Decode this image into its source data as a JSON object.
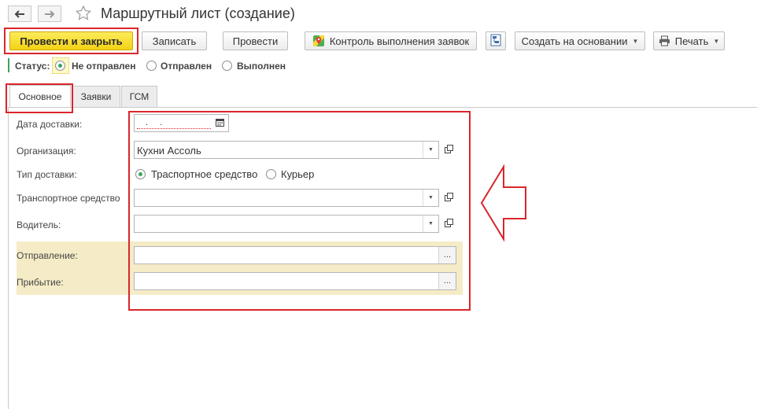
{
  "window": {
    "title": "Маршрутный лист (создание)"
  },
  "nav": {
    "back_icon": "arrow-left-icon",
    "forward_icon": "arrow-right-icon",
    "favorite_icon": "star-icon"
  },
  "toolbar": {
    "post_close_label": "Провести и закрыть",
    "save_label": "Записать",
    "post_label": "Провести",
    "control_label": "Контроль выполнения заявок",
    "create_based_label": "Создать на основании",
    "print_label": "Печать"
  },
  "status": {
    "label": "Статус:",
    "options": [
      "Не отправлен",
      "Отправлен",
      "Выполнен"
    ],
    "selected": "Не отправлен"
  },
  "tabs": [
    "Основное",
    "Заявки",
    "ГСМ"
  ],
  "active_tab": "Основное",
  "form": {
    "delivery_date": {
      "label": "Дата доставки:",
      "value": ". ."
    },
    "organization": {
      "label": "Организация:",
      "value": "Кухни Ассоль"
    },
    "delivery_type": {
      "label": "Тип доставки:",
      "options": [
        "Траспортное средство",
        "Курьер"
      ],
      "selected": "Траспортное средство"
    },
    "vehicle": {
      "label": "Транспортное средство",
      "value": ""
    },
    "driver": {
      "label": "Водитель:",
      "value": ""
    },
    "departure": {
      "label": "Отправление:",
      "value": ""
    },
    "arrival": {
      "label": "Прибытие:",
      "value": ""
    }
  },
  "colors": {
    "accent_yellow": "#f4d214",
    "highlight_red": "#d9262c",
    "status_green": "#3aa55b",
    "group_background": "#f5ecc7"
  }
}
